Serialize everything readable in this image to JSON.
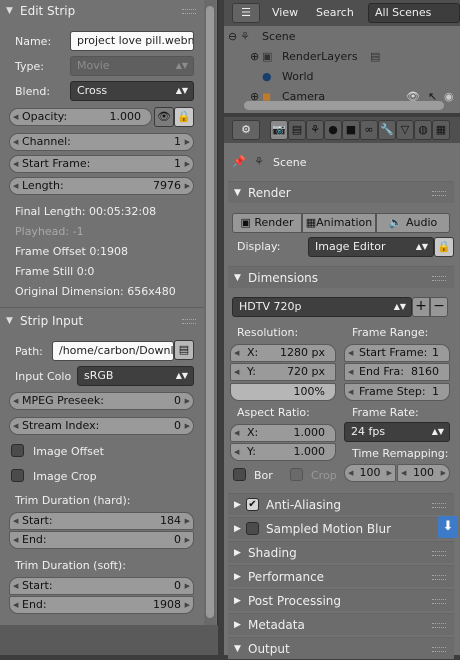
{
  "left": {
    "edit_strip": {
      "title": "Edit Strip",
      "name_label": "Name:",
      "name_value": "project love pill.webm",
      "type_label": "Type:",
      "type_value": "Movie",
      "blend_label": "Blend:",
      "blend_value": "Cross",
      "opacity_label": "Opacity:",
      "opacity_value": "1.000",
      "channel_label": "Channel:",
      "channel_value": "1",
      "start_label": "Start Frame:",
      "start_value": "1",
      "length_label": "Length:",
      "length_value": "7976",
      "final_length": "Final Length: 00:05:32:08",
      "playhead": "Playhead: -1",
      "frame_offset": "Frame Offset 0:1908",
      "frame_still": "Frame Still 0:0",
      "orig_dim": "Original Dimension: 656x480"
    },
    "strip_input": {
      "title": "Strip Input",
      "path_label": "Path:",
      "path_value": "/home/carbon/Downl...",
      "colo_label": "Input Colo",
      "colo_value": "sRGB",
      "mpeg_label": "MPEG Preseek:",
      "mpeg_value": "0",
      "stream_label": "Stream Index:",
      "stream_value": "0",
      "image_offset": "Image Offset",
      "image_crop": "Image Crop",
      "trim_hard": "Trim Duration (hard):",
      "hard_start_label": "Start:",
      "hard_start_value": "184",
      "hard_end_label": "End:",
      "hard_end_value": "0",
      "trim_soft": "Trim Duration (soft):",
      "soft_start_label": "Start:",
      "soft_start_value": "0",
      "soft_end_label": "End:",
      "soft_end_value": "1908"
    }
  },
  "outliner": {
    "view": "View",
    "search": "Search",
    "scenes": "All Scenes",
    "rows": [
      "Scene",
      "RenderLayers",
      "World",
      "Camera"
    ]
  },
  "props": {
    "scene": "Scene",
    "render": {
      "title": "Render",
      "render_btn": "Render",
      "anim_btn": "Animation",
      "audio_btn": "Audio",
      "display_label": "Display:",
      "display_value": "Image Editor"
    },
    "dimensions": {
      "title": "Dimensions",
      "preset": "HDTV 720p",
      "resolution": "Resolution:",
      "x_label": "X:",
      "x_value": "1280 px",
      "y_label": "Y:",
      "y_value": "720 px",
      "pct": "100%",
      "frame_range": "Frame Range:",
      "start_label": "Start Frame:",
      "start_value": "1",
      "end_label": "End Fra:",
      "end_value": "8160",
      "step_label": "Frame Step:",
      "step_value": "1",
      "aspect": "Aspect Ratio:",
      "ax_label": "X:",
      "ax_value": "1.000",
      "ay_label": "Y:",
      "ay_value": "1.000",
      "frame_rate": "Frame Rate:",
      "fps": "24 fps",
      "bor": "Bor",
      "crop": "Crop",
      "remap": "Time Remapping:",
      "remap_old": "100",
      "remap_new": "100"
    },
    "sections": [
      "Anti-Aliasing",
      "Sampled Motion Blur",
      "Shading",
      "Performance",
      "Post Processing",
      "Metadata",
      "Output"
    ]
  }
}
